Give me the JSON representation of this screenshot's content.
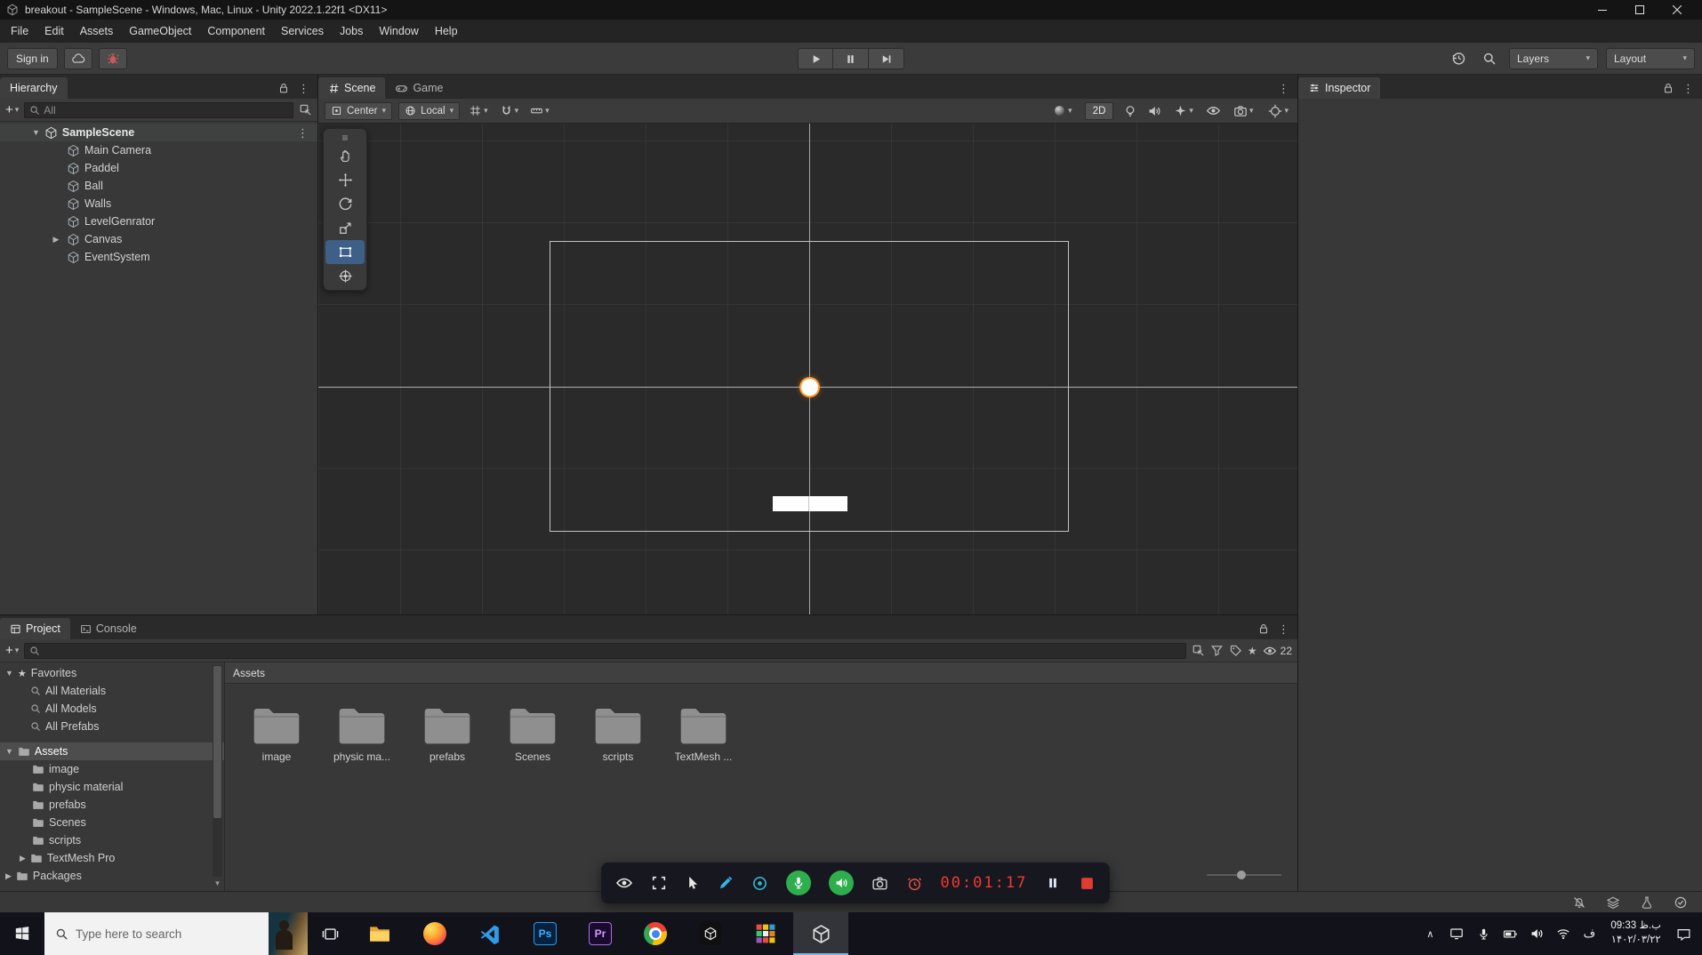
{
  "titlebar": {
    "title": "breakout - SampleScene - Windows, Mac, Linux - Unity 2022.1.22f1 <DX11>"
  },
  "menubar": {
    "items": [
      "File",
      "Edit",
      "Assets",
      "GameObject",
      "Component",
      "Services",
      "Jobs",
      "Window",
      "Help"
    ]
  },
  "toolbar": {
    "sign_in": "Sign in",
    "layers": "Layers",
    "layout": "Layout"
  },
  "hierarchy": {
    "tab": "Hierarchy",
    "search_placeholder": "All",
    "scene_name": "SampleScene",
    "objects": [
      "Main Camera",
      "Paddel",
      "Ball",
      "Walls",
      "LevelGenrator",
      "Canvas",
      "EventSystem"
    ]
  },
  "scene": {
    "tab_scene": "Scene",
    "tab_game": "Game",
    "pivot": "Center",
    "orientation": "Local",
    "mode_2d": "2D"
  },
  "inspector": {
    "tab": "Inspector"
  },
  "project": {
    "tab_project": "Project",
    "tab_console": "Console",
    "favorites_label": "Favorites",
    "favorites": [
      "All Materials",
      "All Models",
      "All Prefabs"
    ],
    "assets_label": "Assets",
    "tree_folders": [
      "image",
      "physic material",
      "prefabs",
      "Scenes",
      "scripts",
      "TextMesh Pro"
    ],
    "packages_label": "Packages",
    "breadcrumb": "Assets",
    "grid_folders": [
      "image",
      "physic ma...",
      "prefabs",
      "Scenes",
      "scripts",
      "TextMesh ..."
    ],
    "hidden_count": "22"
  },
  "recorder": {
    "timer": "00:01:17"
  },
  "taskbar": {
    "search_placeholder": "Type here to search",
    "apps": {
      "photoshop": "Ps",
      "premiere": "Pr"
    },
    "language": "ف",
    "time": "09:33 ب.ظ",
    "date": "۱۴۰۲/۰۳/۲۲"
  },
  "glyphs": {
    "caret_down": "▾",
    "tri_down": "▼",
    "tri_right": "▶",
    "kebab": "⋮",
    "plus": "+",
    "star": "★",
    "handle": "≡",
    "chevron_up": "∧"
  },
  "colors": {
    "selection_blue": "#3e5f87",
    "selected_outline_orange": "#ff9b2d",
    "record_red": "#f03a30",
    "mic_green": "#2fae4e"
  }
}
